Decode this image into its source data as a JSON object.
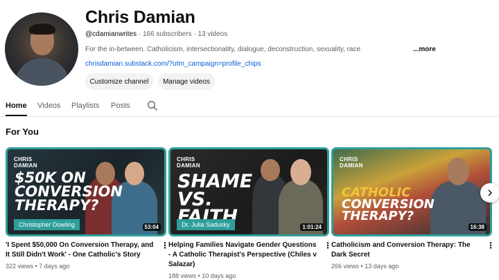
{
  "channel": {
    "name": "Chris Damian",
    "handle": "@cdamianwrites",
    "subscribers": "166 subscribers",
    "video_count": "13 videos",
    "description": "For the in-between. Catholicism, intersectionality, dialogue, deconstruction, sexuality, race",
    "more_label": "...more",
    "link": "chrisdamian.substack.com/?utm_campaign=profile_chips",
    "customize_label": "Customize channel",
    "manage_label": "Manage videos"
  },
  "tabs": [
    {
      "label": "Home"
    },
    {
      "label": "Videos"
    },
    {
      "label": "Playlists"
    },
    {
      "label": "Posts"
    }
  ],
  "section": {
    "title": "For You"
  },
  "videos": [
    {
      "title": "'I Spent $50,000 On Conversion Therapy, and It Still Didn't Work' - One Catholic's Story",
      "views": "322 views",
      "age": "7 days ago",
      "duration": "53:04",
      "thumb_brand": "CHRIS\nDAMIAN",
      "thumb_text": "$50K ON CONVERSION THERAPY?",
      "thumb_tag": "Christopher Dowling"
    },
    {
      "title": "Helping Families Navigate Gender Questions - A Catholic Therapist's Perspective (Chiles v Salazar)",
      "views": "188 views",
      "age": "10 days ago",
      "duration": "1:01:24",
      "thumb_brand": "CHRIS\nDAMIAN",
      "thumb_text": "SHAME VS. FAITH",
      "thumb_tag": "Dr. Julia Sadusky"
    },
    {
      "title": "Catholicism and Conversion Therapy: The Dark Secret",
      "views": "266 views",
      "age": "13 days ago",
      "duration": "16:38",
      "thumb_brand": "CHRIS\nDAMIAN",
      "thumb_text_line1": "CATHOLIC",
      "thumb_text_line2": "CONVERSION",
      "thumb_text_line3": "THERAPY?"
    }
  ],
  "colors": {
    "accent_teal": "#2f9e9a",
    "link_blue": "#065fd4",
    "pill_bg": "#f2f2f2"
  },
  "icons": [
    "search-icon",
    "kebab-menu-icon",
    "chevron-right-icon"
  ]
}
